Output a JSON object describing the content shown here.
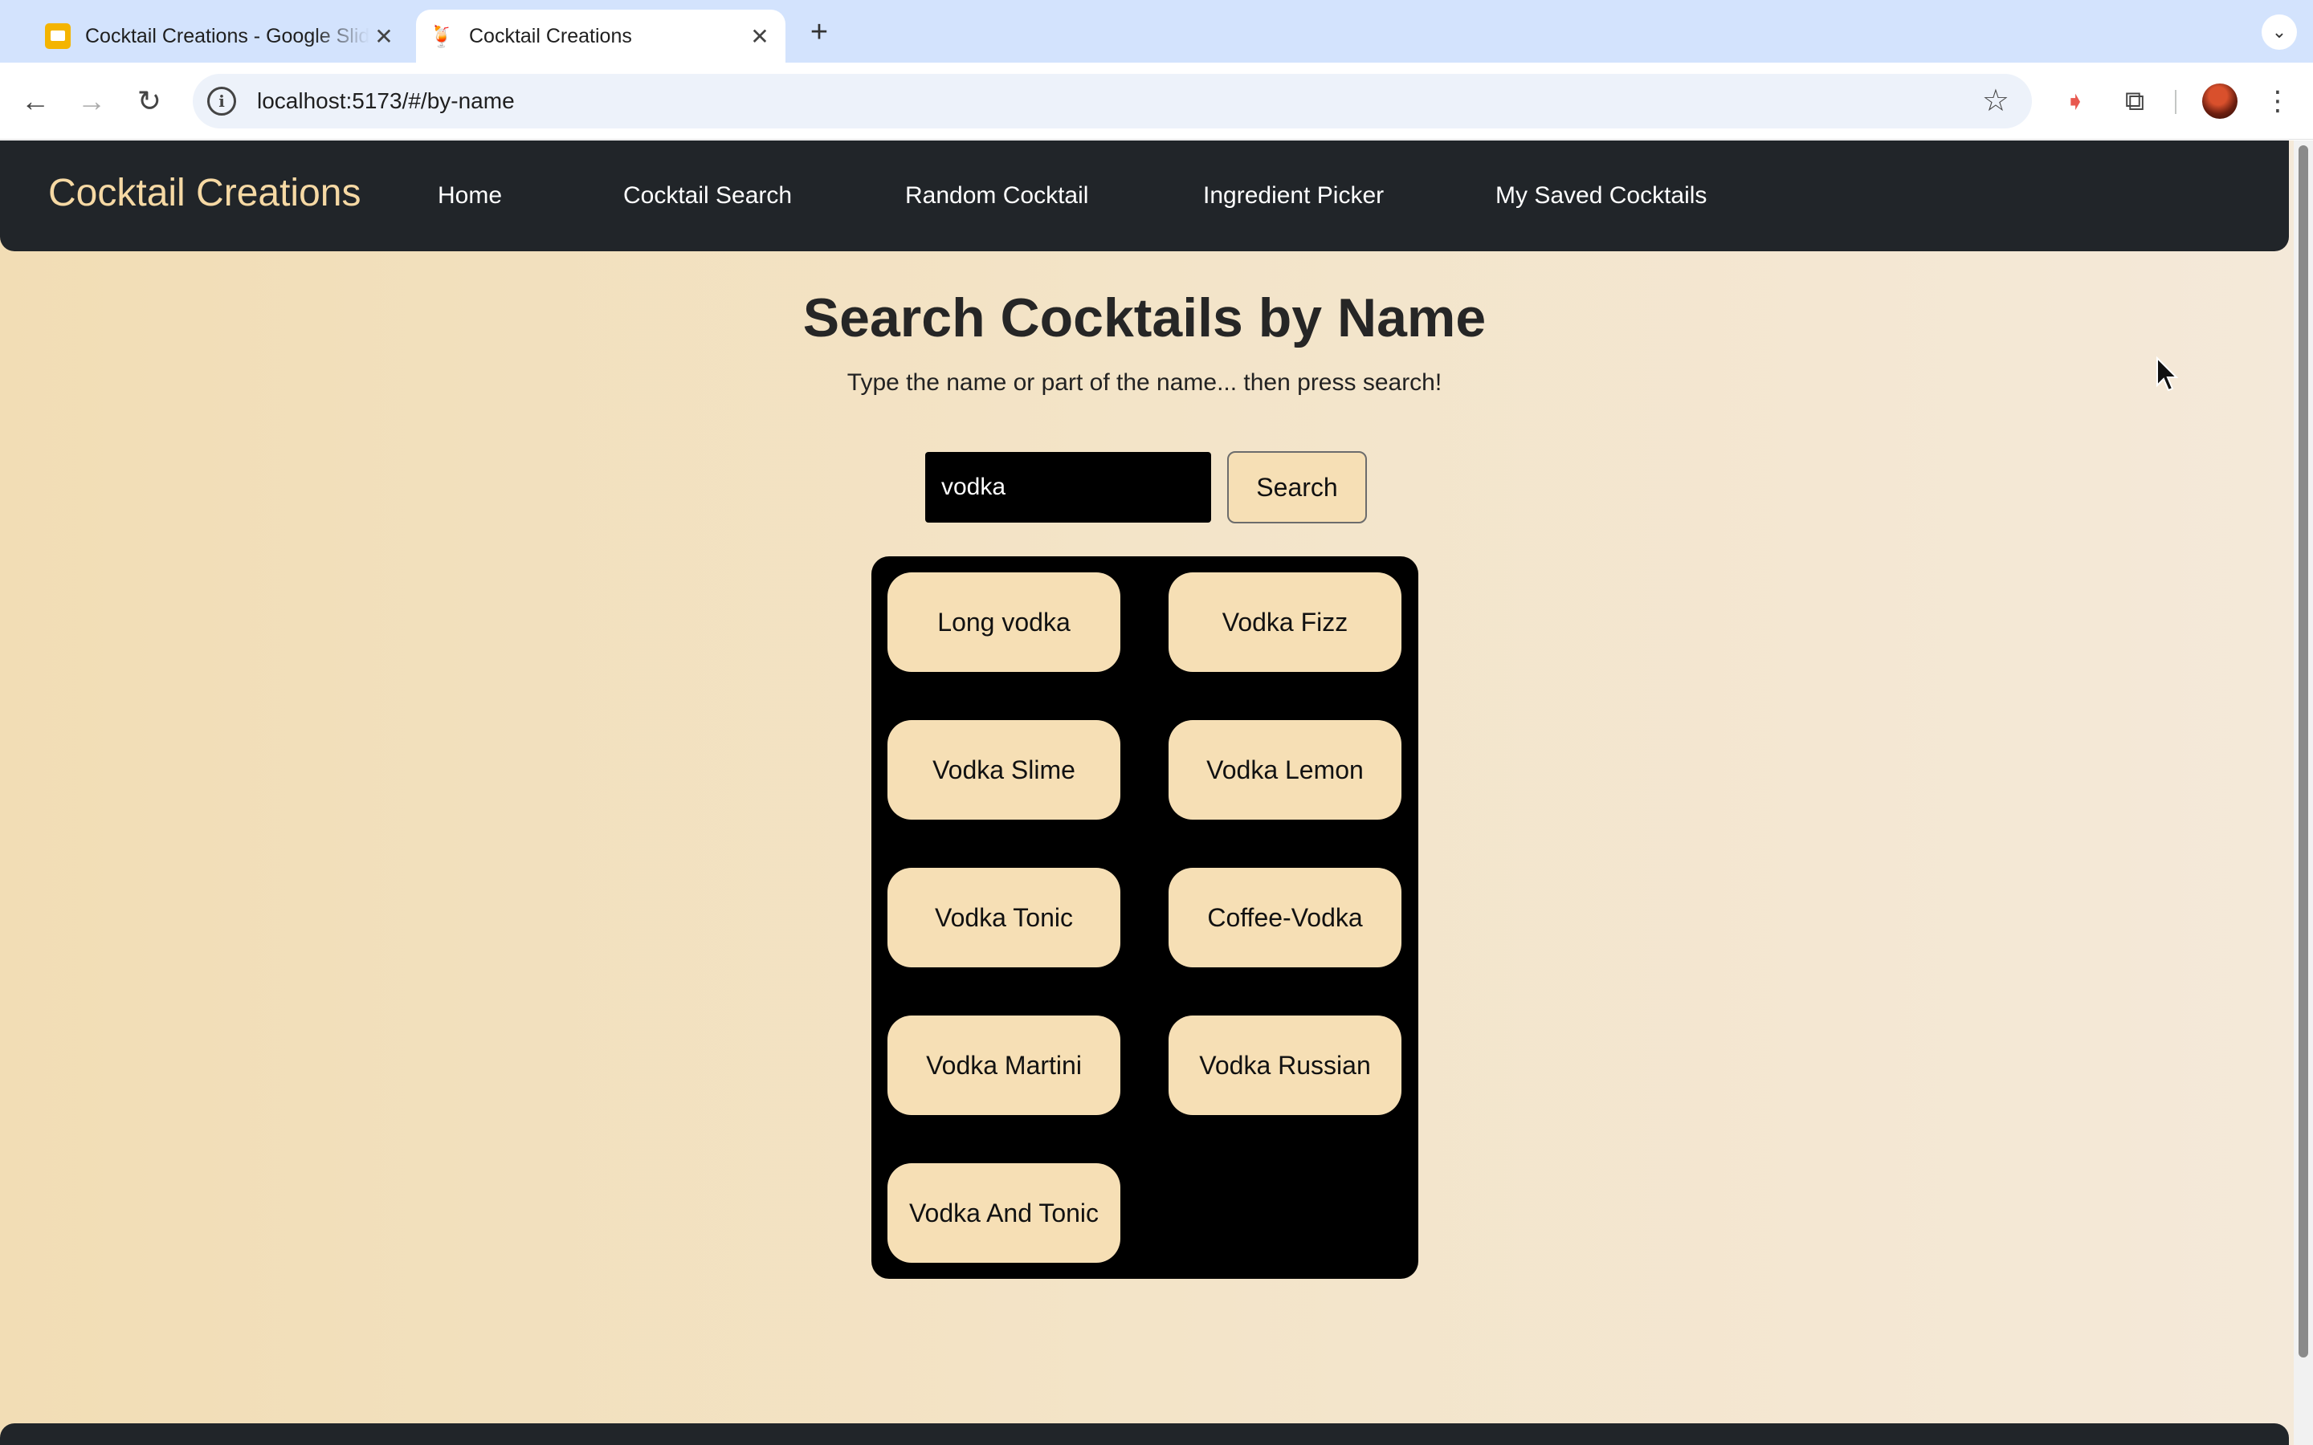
{
  "browser": {
    "tabs": [
      {
        "title": "Cocktail Creations - Google Slides",
        "active": false
      },
      {
        "title": "Cocktail Creations",
        "active": true
      }
    ],
    "url": "localhost:5173/#/by-name"
  },
  "site": {
    "brand": "Cocktail Creations",
    "nav": [
      "Home",
      "Cocktail Search",
      "Random Cocktail",
      "Ingredient Picker",
      "My Saved Cocktails"
    ]
  },
  "page": {
    "heading": "Search Cocktails by Name",
    "subheading": "Type the name or part of the name... then press search!",
    "search_value": "vodka",
    "search_button": "Search",
    "results": [
      "Long vodka",
      "Vodka Fizz",
      "Vodka Slime",
      "Vodka Lemon",
      "Vodka Tonic",
      "Coffee-Vodka",
      "Vodka Martini",
      "Vodka Russian",
      "Vodka And Tonic"
    ]
  },
  "colors": {
    "navbar": "#212529",
    "brand": "#f6d9a4",
    "accent_tan": "#f6dfb5",
    "results_bg": "#000000"
  }
}
